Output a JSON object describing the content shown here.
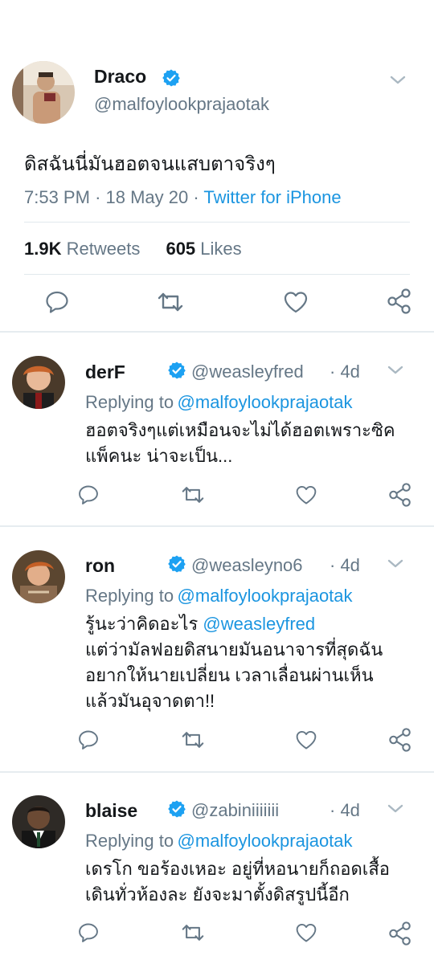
{
  "main_tweet": {
    "name": "Draco",
    "handle": "@malfoylookprajaotak",
    "text": "ดิสฉันนี่มันฮอตจนแสบตาจริงๆ",
    "time": "7:53 PM",
    "date": "· 18 May 20 ·",
    "source": "Twitter for iPhone",
    "retweets_count": "1.9K",
    "retweets_label": "Retweets",
    "likes_count": "605",
    "likes_label": "Likes"
  },
  "replies": [
    {
      "name": "derF",
      "handle": "@weasleyfred",
      "age": "· 4d",
      "replying_prefix": "Replying to",
      "replying_to": "@malfoylookprajaotak",
      "lines": [
        "ฮอตจริงๆแต่เหมือนจะไม่ได้ฮอตเพราะซิค",
        "แพ็คนะ น่าจะเป็น..."
      ]
    },
    {
      "name": "ron",
      "handle": "@weasleyno6",
      "age": "· 4d",
      "replying_prefix": "Replying to",
      "replying_to": "@malfoylookprajaotak",
      "line1_prefix": "รู้นะว่าคิดอะไร",
      "line1_mention": "@weasleyfred",
      "lines": [
        "แต่ว่ามัลฟอยดิสนายมันอนาจารที่สุดฉัน",
        "อยากให้นายเปลี่ยน เวลาเลื่อนผ่านเห็น",
        "แล้วมันอุจาดตา!!"
      ]
    },
    {
      "name": "blaise",
      "handle": "@zabiniiiiiii",
      "age": "· 4d",
      "replying_prefix": "Replying to",
      "replying_to": "@malfoylookprajaotak",
      "lines": [
        "เดรโก ขอร้องเหอะ อยู่ที่หอนายก็ถอดเสื้อ",
        "เดินทั่วห้องละ ยังจะมาตั้งดิสรูปนี้อีก"
      ]
    }
  ],
  "icons": {
    "reply": "reply-icon",
    "retweet": "retweet-icon",
    "like": "heart-icon",
    "share": "share-icon",
    "verified": "verified-badge-icon",
    "more": "chevron-down-icon"
  },
  "colors": {
    "verified": "#1da1f2",
    "link": "#1b95e0",
    "secondary_text": "#657786",
    "icon": "#657786"
  }
}
